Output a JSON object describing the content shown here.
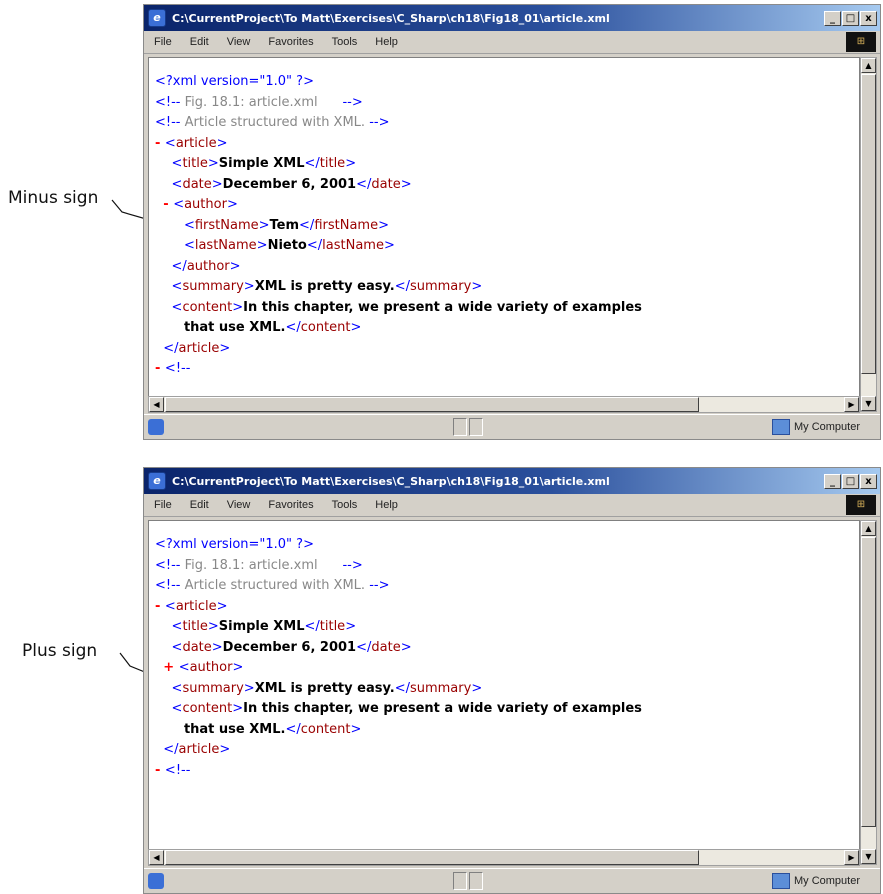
{
  "callouts": {
    "minus_label": "Minus sign",
    "plus_label": "Plus sign"
  },
  "window_common": {
    "title": "C:\\CurrentProject\\To Matt\\Exercises\\C_Sharp\\ch18\\Fig18_01\\article.xml",
    "menu": [
      "File",
      "Edit",
      "View",
      "Favorites",
      "Tools",
      "Help"
    ],
    "buttons": {
      "minimize": "_",
      "maximize": "□",
      "close": "x"
    },
    "status_zone": "My Computer"
  },
  "expanded": {
    "lines": [
      [
        {
          "t": "bracket",
          "v": "<?"
        },
        {
          "t": "pi",
          "v": "xml version=\"1.0\" "
        },
        {
          "t": "bracket",
          "v": "?>"
        }
      ],
      [
        {
          "t": "bracket",
          "v": "<!--"
        },
        {
          "t": "comment",
          "v": " Fig. 18.1: article.xml      "
        },
        {
          "t": "bracket",
          "v": "-->"
        }
      ],
      [
        {
          "t": "bracket",
          "v": "<!--"
        },
        {
          "t": "comment",
          "v": " Article structured with XML. "
        },
        {
          "t": "bracket",
          "v": "-->"
        }
      ],
      [
        {
          "t": "marker",
          "v": "- "
        },
        {
          "t": "bracket",
          "v": "<"
        },
        {
          "t": "tag",
          "v": "article"
        },
        {
          "t": "bracket",
          "v": ">"
        }
      ],
      [
        {
          "t": "indent",
          "v": "    "
        },
        {
          "t": "bracket",
          "v": "<"
        },
        {
          "t": "tag",
          "v": "title"
        },
        {
          "t": "bracket",
          "v": ">"
        },
        {
          "t": "text",
          "v": "Simple XML"
        },
        {
          "t": "bracket",
          "v": "</"
        },
        {
          "t": "tag",
          "v": "title"
        },
        {
          "t": "bracket",
          "v": ">"
        }
      ],
      [
        {
          "t": "indent",
          "v": "    "
        },
        {
          "t": "bracket",
          "v": "<"
        },
        {
          "t": "tag",
          "v": "date"
        },
        {
          "t": "bracket",
          "v": ">"
        },
        {
          "t": "text",
          "v": "December 6, 2001"
        },
        {
          "t": "bracket",
          "v": "</"
        },
        {
          "t": "tag",
          "v": "date"
        },
        {
          "t": "bracket",
          "v": ">"
        }
      ],
      [
        {
          "t": "indent",
          "v": "  "
        },
        {
          "t": "marker",
          "v": "- "
        },
        {
          "t": "bracket",
          "v": "<"
        },
        {
          "t": "tag",
          "v": "author"
        },
        {
          "t": "bracket",
          "v": ">"
        }
      ],
      [
        {
          "t": "indent",
          "v": "       "
        },
        {
          "t": "bracket",
          "v": "<"
        },
        {
          "t": "tag",
          "v": "firstName"
        },
        {
          "t": "bracket",
          "v": ">"
        },
        {
          "t": "text",
          "v": "Tem"
        },
        {
          "t": "bracket",
          "v": "</"
        },
        {
          "t": "tag",
          "v": "firstName"
        },
        {
          "t": "bracket",
          "v": ">"
        }
      ],
      [
        {
          "t": "indent",
          "v": "       "
        },
        {
          "t": "bracket",
          "v": "<"
        },
        {
          "t": "tag",
          "v": "lastName"
        },
        {
          "t": "bracket",
          "v": ">"
        },
        {
          "t": "text",
          "v": "Nieto"
        },
        {
          "t": "bracket",
          "v": "</"
        },
        {
          "t": "tag",
          "v": "lastName"
        },
        {
          "t": "bracket",
          "v": ">"
        }
      ],
      [
        {
          "t": "indent",
          "v": "    "
        },
        {
          "t": "bracket",
          "v": "</"
        },
        {
          "t": "tag",
          "v": "author"
        },
        {
          "t": "bracket",
          "v": ">"
        }
      ],
      [
        {
          "t": "indent",
          "v": "    "
        },
        {
          "t": "bracket",
          "v": "<"
        },
        {
          "t": "tag",
          "v": "summary"
        },
        {
          "t": "bracket",
          "v": ">"
        },
        {
          "t": "text",
          "v": "XML is pretty easy."
        },
        {
          "t": "bracket",
          "v": "</"
        },
        {
          "t": "tag",
          "v": "summary"
        },
        {
          "t": "bracket",
          "v": ">"
        }
      ],
      [
        {
          "t": "indent",
          "v": "    "
        },
        {
          "t": "bracket",
          "v": "<"
        },
        {
          "t": "tag",
          "v": "content"
        },
        {
          "t": "bracket",
          "v": ">"
        },
        {
          "t": "text",
          "v": "In this chapter, we present a wide variety of examples"
        }
      ],
      [
        {
          "t": "indent",
          "v": "       "
        },
        {
          "t": "text",
          "v": "that use XML."
        },
        {
          "t": "bracket",
          "v": "</"
        },
        {
          "t": "tag",
          "v": "content"
        },
        {
          "t": "bracket",
          "v": ">"
        }
      ],
      [
        {
          "t": "indent",
          "v": "  "
        },
        {
          "t": "bracket",
          "v": "</"
        },
        {
          "t": "tag",
          "v": "article"
        },
        {
          "t": "bracket",
          "v": ">"
        }
      ],
      [
        {
          "t": "marker",
          "v": "- "
        },
        {
          "t": "bracket",
          "v": "<!--"
        }
      ]
    ]
  },
  "collapsed": {
    "lines": [
      [
        {
          "t": "bracket",
          "v": "<?"
        },
        {
          "t": "pi",
          "v": "xml version=\"1.0\" "
        },
        {
          "t": "bracket",
          "v": "?>"
        }
      ],
      [
        {
          "t": "bracket",
          "v": "<!--"
        },
        {
          "t": "comment",
          "v": " Fig. 18.1: article.xml      "
        },
        {
          "t": "bracket",
          "v": "-->"
        }
      ],
      [
        {
          "t": "bracket",
          "v": "<!--"
        },
        {
          "t": "comment",
          "v": " Article structured with XML. "
        },
        {
          "t": "bracket",
          "v": "-->"
        }
      ],
      [
        {
          "t": "marker",
          "v": "- "
        },
        {
          "t": "bracket",
          "v": "<"
        },
        {
          "t": "tag",
          "v": "article"
        },
        {
          "t": "bracket",
          "v": ">"
        }
      ],
      [
        {
          "t": "indent",
          "v": "    "
        },
        {
          "t": "bracket",
          "v": "<"
        },
        {
          "t": "tag",
          "v": "title"
        },
        {
          "t": "bracket",
          "v": ">"
        },
        {
          "t": "text",
          "v": "Simple XML"
        },
        {
          "t": "bracket",
          "v": "</"
        },
        {
          "t": "tag",
          "v": "title"
        },
        {
          "t": "bracket",
          "v": ">"
        }
      ],
      [
        {
          "t": "indent",
          "v": "    "
        },
        {
          "t": "bracket",
          "v": "<"
        },
        {
          "t": "tag",
          "v": "date"
        },
        {
          "t": "bracket",
          "v": ">"
        },
        {
          "t": "text",
          "v": "December 6, 2001"
        },
        {
          "t": "bracket",
          "v": "</"
        },
        {
          "t": "tag",
          "v": "date"
        },
        {
          "t": "bracket",
          "v": ">"
        }
      ],
      [
        {
          "t": "indent",
          "v": "  "
        },
        {
          "t": "marker",
          "v": "+ "
        },
        {
          "t": "bracket",
          "v": "<"
        },
        {
          "t": "tag",
          "v": "author"
        },
        {
          "t": "bracket",
          "v": ">"
        }
      ],
      [
        {
          "t": "indent",
          "v": "    "
        },
        {
          "t": "bracket",
          "v": "<"
        },
        {
          "t": "tag",
          "v": "summary"
        },
        {
          "t": "bracket",
          "v": ">"
        },
        {
          "t": "text",
          "v": "XML is pretty easy."
        },
        {
          "t": "bracket",
          "v": "</"
        },
        {
          "t": "tag",
          "v": "summary"
        },
        {
          "t": "bracket",
          "v": ">"
        }
      ],
      [
        {
          "t": "indent",
          "v": "    "
        },
        {
          "t": "bracket",
          "v": "<"
        },
        {
          "t": "tag",
          "v": "content"
        },
        {
          "t": "bracket",
          "v": ">"
        },
        {
          "t": "text",
          "v": "In this chapter, we present a wide variety of examples"
        }
      ],
      [
        {
          "t": "indent",
          "v": "       "
        },
        {
          "t": "text",
          "v": "that use XML."
        },
        {
          "t": "bracket",
          "v": "</"
        },
        {
          "t": "tag",
          "v": "content"
        },
        {
          "t": "bracket",
          "v": ">"
        }
      ],
      [
        {
          "t": "indent",
          "v": "  "
        },
        {
          "t": "bracket",
          "v": "</"
        },
        {
          "t": "tag",
          "v": "article"
        },
        {
          "t": "bracket",
          "v": ">"
        }
      ],
      [
        {
          "t": "marker",
          "v": "- "
        },
        {
          "t": "bracket",
          "v": "<!--"
        }
      ]
    ]
  }
}
